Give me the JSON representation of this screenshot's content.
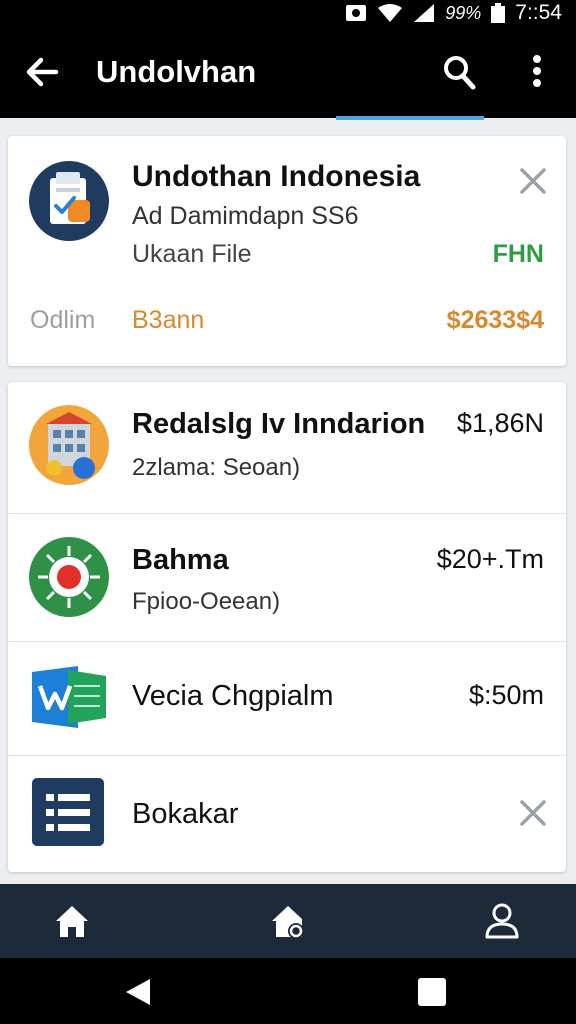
{
  "status_bar": {
    "battery": "99%",
    "time": "7::54"
  },
  "app_bar": {
    "title": "Undolvhan"
  },
  "featured_card": {
    "title": "Undothan Indonesia",
    "line1": "Ad Damimdapn SS6",
    "line2": "Ukaan File",
    "badge": "FHN",
    "left_label": "Odlim",
    "middle_label": "B3ann",
    "amount": "$2633$4",
    "badge_color": "#2e9e44",
    "accent_color": "#d9892a"
  },
  "list_items": [
    {
      "name": "Redalslg Iv Inndarion",
      "sub": "2zlama: Seoan)",
      "price": "$1,86N",
      "icon": "building-icon"
    },
    {
      "name": "Bahma",
      "sub": "Fpioo-Oeean)",
      "price": "$20+.Tm",
      "icon": "target-icon"
    },
    {
      "name": "Vecia Chgpialm",
      "price": "$:50m",
      "icon": "document-app-icon"
    },
    {
      "name": "Bokakar",
      "icon": "list-icon"
    }
  ],
  "bottom_nav": [
    "home-icon",
    "home-settings-icon",
    "profile-icon"
  ],
  "system_nav": [
    "back-triangle-icon",
    "overview-square-icon"
  ]
}
